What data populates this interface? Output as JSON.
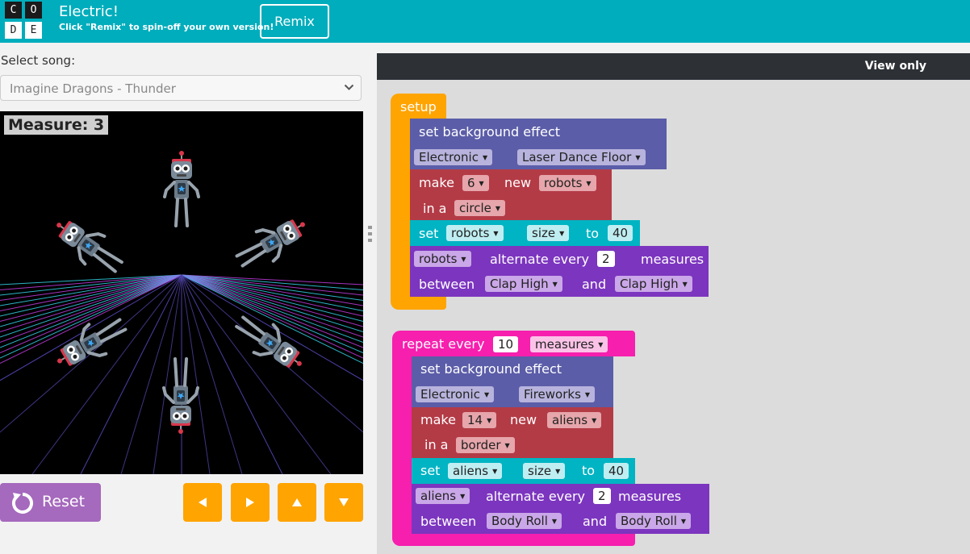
{
  "header": {
    "logo_letters": [
      "C",
      "O",
      "D",
      "E"
    ],
    "title": "Electric!",
    "subtitle": "Click \"Remix\" to spin-off your own version!",
    "remix_label": "Remix"
  },
  "song": {
    "label": "Select song:",
    "selected": "Imagine Dragons - Thunder"
  },
  "stage": {
    "measure_text": "Measure: 3"
  },
  "controls": {
    "reset_label": "Reset"
  },
  "workspace": {
    "view_only_label": "View only",
    "setup": {
      "hat": "setup",
      "bg_label": "set background effect",
      "bg_category": "Electronic",
      "bg_effect": "Laser Dance Floor",
      "make_label": "make",
      "count": "6",
      "new_label": "new",
      "sprite": "robots",
      "in_a_label": "in a",
      "layout": "circle",
      "set_label": "set",
      "set_sprite": "robots",
      "property": "size",
      "to_label": "to",
      "value": "40",
      "alt_sprite": "robots",
      "alternate_label": "alternate every",
      "alt_count": "2",
      "measures_label": "measures",
      "between_label": "between",
      "move_a": "Clap High",
      "and_label": "and",
      "move_b": "Clap High"
    },
    "repeat": {
      "hat_label": "repeat every",
      "interval": "10",
      "unit": "measures",
      "bg_label": "set background effect",
      "bg_category": "Electronic",
      "bg_effect": "Fireworks",
      "make_label": "make",
      "count": "14",
      "new_label": "new",
      "sprite": "aliens",
      "in_a_label": "in a",
      "layout": "border",
      "set_label": "set",
      "set_sprite": "aliens",
      "property": "size",
      "to_label": "to",
      "value": "40",
      "alt_sprite": "aliens",
      "alternate_label": "alternate every",
      "alt_count": "2",
      "measures_label": "measures",
      "between_label": "between",
      "move_a": "Body Roll",
      "and_label": "and",
      "move_b": "Body Roll"
    }
  },
  "colors": {
    "header": "#00adbc",
    "setup_block": "#ffa400",
    "repeat_block": "#f61fae",
    "background_block": "#5b5da8",
    "make_block": "#b33b46",
    "set_block": "#00b4c3",
    "alternate_block": "#7c35bf",
    "reset_button": "#a569bd",
    "arrow_button": "#ffa400"
  }
}
